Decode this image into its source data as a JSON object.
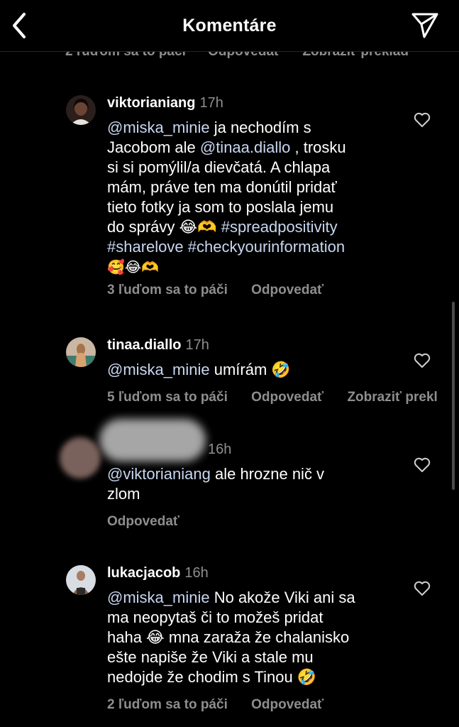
{
  "header": {
    "title": "Komentáre"
  },
  "peek_actions": [
    "2 ľuďom sa to páči",
    "Odpovedať",
    "Zobraziť preklad"
  ],
  "comments": [
    {
      "username": "viktorianiang",
      "time": "17h",
      "mention": "@miska_minie",
      "text_a": " ja nechodím s\nJacobom ale ",
      "mention2": "@tinaa.diallo",
      "text_b": " , trosku\nsi si pomýlil/a dievčatá. A chlapa\nmám, práve ten ma donútil pridať\ntieto fotky ja som to poslala jemu\ndo správy 😂🫶 ",
      "hashtag1": "#spreadpositivity",
      "hashtag2": "#sharelove",
      "hashtag3": "#checkyourinformation",
      "emojis_end": "🥰😂🫶",
      "likes": "3 ľuďom sa to páči",
      "reply": "Odpovedať"
    },
    {
      "username": "tinaa.diallo",
      "time": "17h",
      "mention": "@miska_minie",
      "text": " umírám 🤣",
      "likes": "5 ľuďom sa to páči",
      "reply": "Odpovedať",
      "translate": "Zobraziť prekl"
    },
    {
      "time": "16h",
      "mention": "@viktorianiang",
      "text": " ale hrozne nič v\nzlom",
      "reply": "Odpovedať"
    },
    {
      "username": "lukacjacob",
      "time": "16h",
      "mention": "@miska_minie",
      "text": " No akože Viki ani sa\nma neopytaš či to možeš pridat\nhaha 😂 mna zaraža že chalanisko\nešte napiše že Viki a stale mu\nnedojde že chodim s Tinou 🤣",
      "likes": "2 ľuďom sa to páči",
      "reply": "Odpovedať"
    }
  ]
}
